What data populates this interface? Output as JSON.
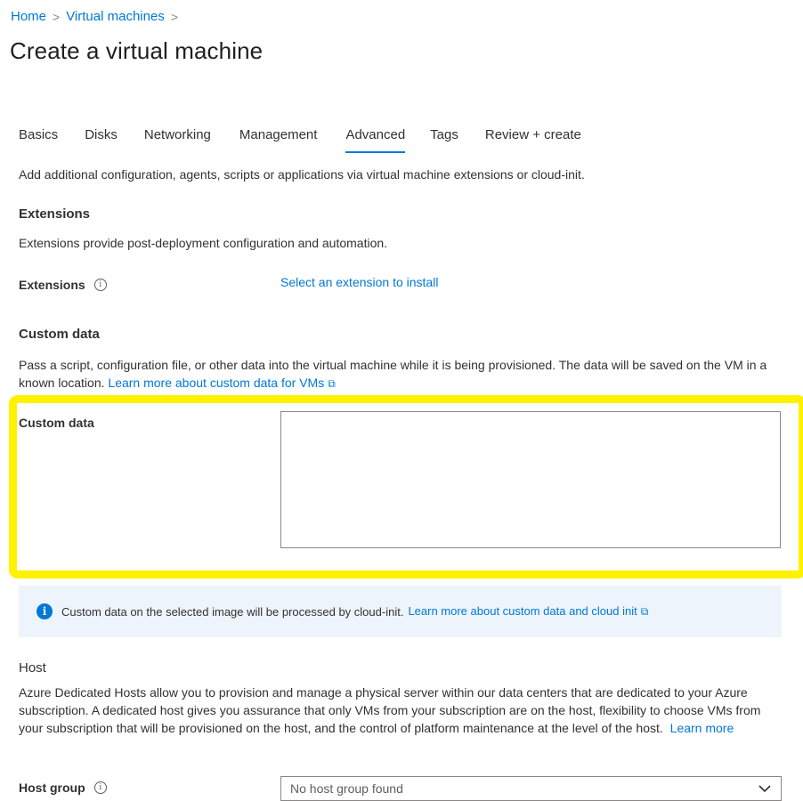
{
  "breadcrumb": {
    "items": [
      "Home",
      "Virtual machines"
    ],
    "separator": ">"
  },
  "page": {
    "title": "Create a virtual machine"
  },
  "tabs": [
    {
      "label": "Basics",
      "active": false
    },
    {
      "label": "Disks",
      "active": false
    },
    {
      "label": "Networking",
      "active": false
    },
    {
      "label": "Management",
      "active": false
    },
    {
      "label": "Advanced",
      "active": true
    },
    {
      "label": "Tags",
      "active": false
    },
    {
      "label": "Review + create",
      "active": false
    }
  ],
  "advanced": {
    "intro": "Add additional configuration, agents, scripts or applications via virtual machine extensions or cloud-init."
  },
  "extensions": {
    "title": "Extensions",
    "description": "Extensions provide post-deployment configuration and automation.",
    "label": "Extensions",
    "link": "Select an extension to install"
  },
  "custom_data": {
    "title": "Custom data",
    "description": "Pass a script, configuration file, or other data into the virtual machine while it is being provisioned. The data will be saved on the VM in a known location.",
    "learn_more": "Learn more about custom data for VMs",
    "label": "Custom data",
    "value": "",
    "highlight_color": "#fff200"
  },
  "cloud_init_banner": {
    "text": "Custom data on the selected image will be processed by cloud-init.",
    "link": "Learn more about custom data and cloud init"
  },
  "host": {
    "title": "Host",
    "description": "Azure Dedicated Hosts allow you to provision and manage a physical server within our data centers that are dedicated to your Azure subscription. A dedicated host gives you assurance that only VMs from your subscription are on the host, flexibility to choose VMs from your subscription that will be provisioned on the host, and the control of platform maintenance at the level of the host.",
    "learn_more": "Learn more",
    "group_label": "Host group",
    "group_value": "No host group found"
  },
  "icons": {
    "info": "info-icon",
    "external_link": "external-link-icon",
    "chevron": "chevron-down-icon"
  },
  "colors": {
    "accent": "#0078d4",
    "banner_bg": "#eef4fb",
    "highlight": "#fff200"
  }
}
